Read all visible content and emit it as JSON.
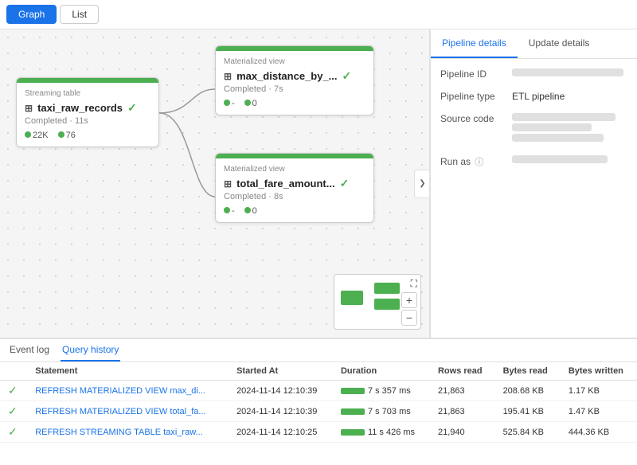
{
  "toolbar": {
    "graph_label": "Graph",
    "list_label": "List"
  },
  "sidebar_toggle": "❯",
  "nodes": {
    "source": {
      "type_label": "Streaming table",
      "title": "taxi_raw_records",
      "status": "Completed · 11s",
      "stat1_value": "22K",
      "stat2_value": "76"
    },
    "mv1": {
      "type_label": "Materialized view",
      "title": "max_distance_by_...",
      "status": "Completed · 7s",
      "stat1_value": "-",
      "stat2_value": "0"
    },
    "mv2": {
      "type_label": "Materialized view",
      "title": "total_fare_amount...",
      "status": "Completed · 8s",
      "stat1_value": "-",
      "stat2_value": "0"
    }
  },
  "right_panel": {
    "tab1_label": "Pipeline details",
    "tab2_label": "Update details",
    "pipeline_id_label": "Pipeline ID",
    "pipeline_type_label": "Pipeline type",
    "pipeline_type_value": "ETL pipeline",
    "source_code_label": "Source code",
    "run_as_label": "Run as"
  },
  "bottom_tabs": {
    "event_log_label": "Event log",
    "query_history_label": "Query history"
  },
  "table": {
    "headers": [
      "Statement",
      "Started At",
      "Duration",
      "Rows read",
      "Bytes read",
      "Bytes written"
    ],
    "rows": [
      {
        "status": "✓",
        "statement": "REFRESH MATERIALIZED VIEW max_di...",
        "started_at": "2024-11-14 12:10:39",
        "duration": "7 s 357 ms",
        "rows_read": "21,863",
        "bytes_read": "208.68 KB",
        "bytes_written": "1.17 KB"
      },
      {
        "status": "✓",
        "statement": "REFRESH MATERIALIZED VIEW total_fa...",
        "started_at": "2024-11-14 12:10:39",
        "duration": "7 s 703 ms",
        "rows_read": "21,863",
        "bytes_read": "195.41 KB",
        "bytes_written": "1.47 KB"
      },
      {
        "status": "✓",
        "statement": "REFRESH STREAMING TABLE taxi_raw...",
        "started_at": "2024-11-14 12:10:25",
        "duration": "11 s 426 ms",
        "rows_read": "21,940",
        "bytes_read": "525.84 KB",
        "bytes_written": "444.36 KB"
      }
    ]
  }
}
